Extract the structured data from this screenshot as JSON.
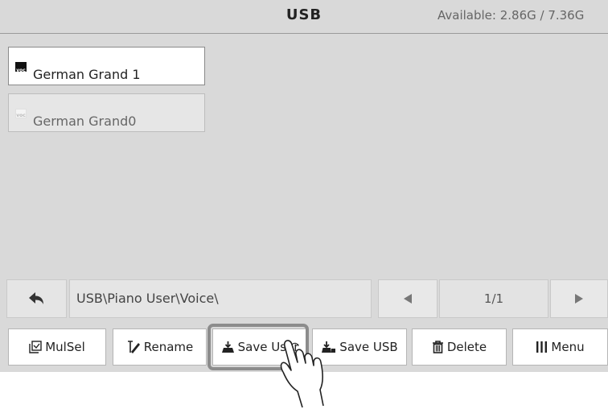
{
  "header": {
    "title": "USB",
    "available": "Available: 2.86G / 7.36G"
  },
  "files": [
    {
      "name": "German Grand 1",
      "icon": "voc",
      "selected": true
    },
    {
      "name": "German Grand0",
      "icon": "voc",
      "selected": false
    }
  ],
  "pathbar": {
    "path": "USB\\Piano User\\Voice\\",
    "page": "1/1"
  },
  "toolbar": {
    "mulsel": "MulSel",
    "rename": "Rename",
    "save_user": "Save User",
    "save_usb": "Save USB",
    "delete": "Delete",
    "menu": "Menu"
  },
  "icons": {
    "back": "back-arrow-icon",
    "prev": "triangle-left-icon",
    "next": "triangle-right-icon",
    "mulsel": "multi-select-icon",
    "rename": "rename-pen-icon",
    "save_user": "save-user-icon",
    "save_usb": "save-usb-icon",
    "delete": "trash-icon",
    "menu": "menu-bars-icon",
    "pointer": "hand-pointer-icon"
  },
  "colors": {
    "background": "#d9d9d9",
    "highlight": "#8c8c8c",
    "selected_item": "#ffffff"
  }
}
